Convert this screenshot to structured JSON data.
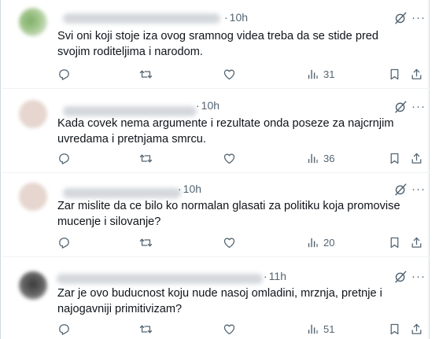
{
  "replies": [
    {
      "time": "10h",
      "text": "Svi oni koji stoje iza ovog sramnog videa treba da se stide pred svojim roditeljima i narodom.",
      "views": "31"
    },
    {
      "time": "10h",
      "text": "Kada covek nema argumente i rezultate onda poseze za najcrnjim uvredama i pretnjama smrcu.",
      "views": "36"
    },
    {
      "time": "10h",
      "text": "Zar mislite da ce bilo ko normalan glasati za politiku koja promovise mucenje i silovanje?",
      "views": "20"
    },
    {
      "time": "11h",
      "text": "Zar je ovo buducnost koju nude nasoj omladini, mrznja, pretnje i najogavniji primitivizam?",
      "views": "51"
    }
  ],
  "icons": {
    "reply": "reply-icon",
    "repost": "repost-icon",
    "like": "heart-icon",
    "views": "views-icon",
    "bookmark": "bookmark-icon",
    "share": "share-icon",
    "grok": "grok-icon",
    "more": "more-icon"
  },
  "colors": {
    "text": "#0f1419",
    "secondary": "#536471",
    "divider": "#eff3f4"
  }
}
